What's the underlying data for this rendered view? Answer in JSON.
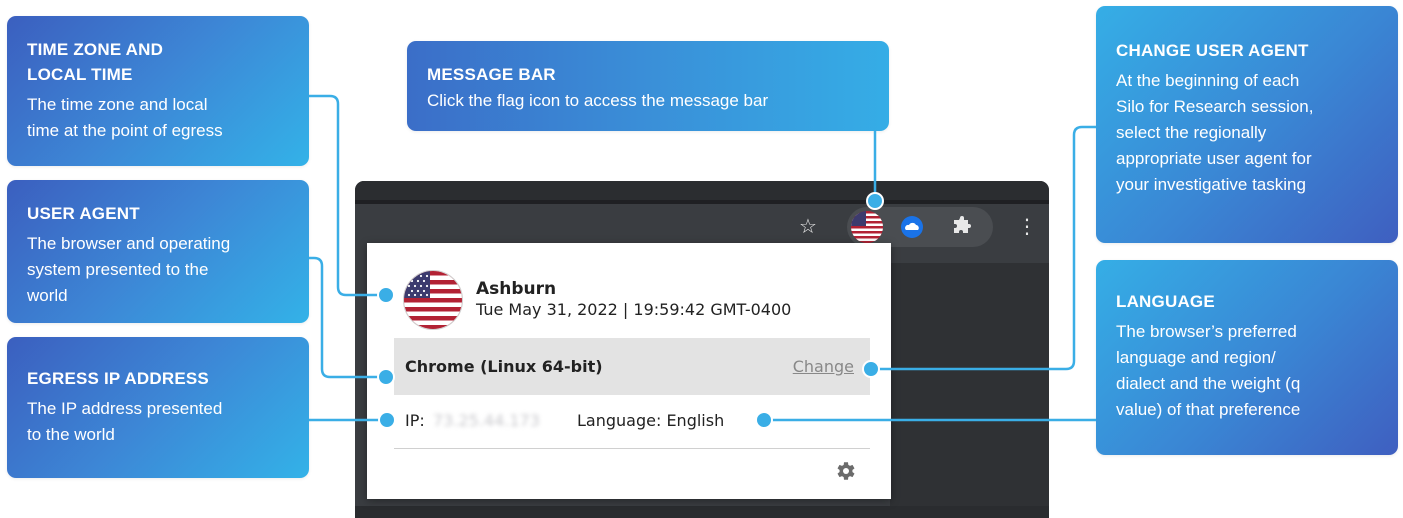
{
  "callouts": {
    "time_zone": {
      "title_line1": "TIME ZONE AND",
      "title_line2": "LOCAL TIME",
      "desc_line1": "The time zone and local",
      "desc_line2": "time at the point of egress"
    },
    "user_agent": {
      "title": "USER AGENT",
      "desc_line1": "The browser and operating",
      "desc_line2": "system presented to the",
      "desc_line3": "world"
    },
    "egress_ip": {
      "title": "EGRESS IP ADDRESS",
      "desc_line1": "The IP address presented",
      "desc_line2": "to the world"
    },
    "message_bar": {
      "title": "MESSAGE BAR",
      "desc": "Click the flag icon to access the message bar"
    },
    "change_user_agent": {
      "title": "CHANGE USER AGENT",
      "desc_line1": "At the beginning of each",
      "desc_line2": "Silo for Research session,",
      "desc_line3": "select the regionally",
      "desc_line4": "appropriate user agent for",
      "desc_line5": "your investigative tasking"
    },
    "language": {
      "title": "LANGUAGE",
      "desc_line1": "The browser’s preferred",
      "desc_line2": "language and region/",
      "desc_line3": "dialect and the weight (q",
      "desc_line4": "value) of that preference"
    }
  },
  "toolbar": {
    "star_icon": "star-icon",
    "flag_icon": "us-flag-icon",
    "cloud_icon": "cloud-icon",
    "puzzle_icon": "puzzle-icon",
    "menu_icon": "kebab-menu-icon"
  },
  "popup": {
    "city": "Ashburn",
    "datetime": "Tue May 31, 2022 | 19:59:42 GMT-0400",
    "user_agent": "Chrome (Linux 64-bit)",
    "change_label": "Change",
    "ip_label": "IP:",
    "ip_value": "73.25.44.173",
    "language_text": "Language: English",
    "gear_icon": "gear-icon"
  },
  "colors": {
    "callout_gradient_start": "#35aee6",
    "callout_gradient_end": "#3f5fc0",
    "connector": "#3aaee6",
    "browser_dark": "#3a3d41"
  }
}
